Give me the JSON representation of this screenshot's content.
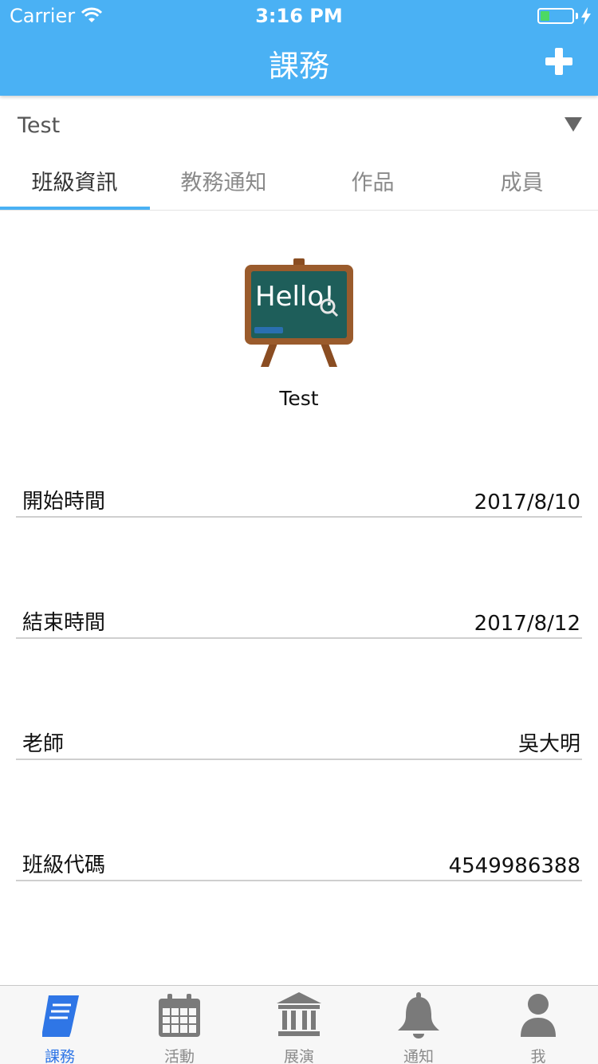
{
  "status_bar": {
    "carrier": "Carrier",
    "time": "3:16 PM",
    "battery_level": 0.3
  },
  "header": {
    "title": "課務",
    "add_icon": "plus-icon"
  },
  "class_selector": {
    "value": "Test",
    "icon": "triangle-down-icon"
  },
  "tabs": [
    {
      "label": "班級資訊",
      "active": true
    },
    {
      "label": "教務通知",
      "active": false
    },
    {
      "label": "作品",
      "active": false
    },
    {
      "label": "成員",
      "active": false
    }
  ],
  "class_info": {
    "image_icon": "chalkboard-hello-icon",
    "image_text": "Hello!",
    "name": "Test",
    "rows": [
      {
        "label": "開始時間",
        "value": "2017/8/10"
      },
      {
        "label": "結束時間",
        "value": "2017/8/12"
      },
      {
        "label": "老師",
        "value": "吳大明"
      },
      {
        "label": "班級代碼",
        "value": "4549986388"
      }
    ]
  },
  "tabbar": {
    "items": [
      {
        "label": "課務",
        "icon": "book-icon",
        "active": true
      },
      {
        "label": "活動",
        "icon": "calendar-icon",
        "active": false
      },
      {
        "label": "展演",
        "icon": "building-icon",
        "active": false
      },
      {
        "label": "通知",
        "icon": "bell-icon",
        "active": false
      },
      {
        "label": "我",
        "icon": "person-icon",
        "active": false
      }
    ]
  },
  "colors": {
    "primary": "#4ab1f4",
    "tab_active_icon": "#2f76e6",
    "inactive": "#8a8a8a",
    "battery": "#4cd964"
  }
}
